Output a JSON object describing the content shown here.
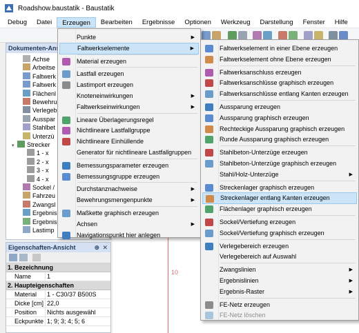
{
  "window": {
    "title": "Roadshow.baustatik - Baustatik"
  },
  "menubar": [
    {
      "label": "Debug"
    },
    {
      "label": "Datei"
    },
    {
      "label": "Erzeugen",
      "active": true
    },
    {
      "label": "Bearbeiten"
    },
    {
      "label": "Ergebnisse"
    },
    {
      "label": "Optionen"
    },
    {
      "label": "Werkzeug"
    },
    {
      "label": "Darstellung"
    },
    {
      "label": "Fenster"
    },
    {
      "label": "Hilfe"
    }
  ],
  "doc_panel": {
    "title": "Dokumenten-Ansicht",
    "items": [
      "Achse",
      "Arbeitse",
      "Faltwerk",
      "Faltwerk",
      "Flächenl",
      "Bewehru",
      "Verlegeb",
      "Ausspar",
      "Stahlbet",
      "Unterzü",
      "Strecker",
      "1 - x",
      "2 - x",
      "3 - x",
      "4 - x",
      "Sockel /",
      "Fahrzeu",
      "Zwangsl",
      "Ergebnis",
      "Ergebnis",
      "Lastimp"
    ]
  },
  "props_panel": {
    "title": "Eigenschaften-Ansicht",
    "pin_glyph": "⊕",
    "close_glyph": "✕",
    "sections": [
      {
        "label": "1. Bezeichnung",
        "rows": [
          {
            "k": "Name",
            "v": "1"
          }
        ]
      },
      {
        "label": "2. Haupteigenschaften",
        "rows": [
          {
            "k": "Material",
            "v": "1 - C30/37 B500S"
          },
          {
            "k": "Dicke [cm]",
            "v": "22,0"
          },
          {
            "k": "Position",
            "v": "Nichts ausgewähl"
          },
          {
            "k": "Eckpunkte",
            "v": "1; 9; 3; 4; 5; 6"
          }
        ]
      }
    ]
  },
  "canvas": {
    "label": "10"
  },
  "menu_erzeugen": [
    {
      "label": "Punkte",
      "sub": true
    },
    {
      "label": "Faltwerkselemente",
      "sub": true,
      "hl": true
    },
    {
      "sep": true
    },
    {
      "label": "Material erzeugen",
      "icon": "material-icon"
    },
    {
      "sep": true
    },
    {
      "label": "Lastfall erzeugen",
      "icon": "load-case-icon"
    },
    {
      "label": "Lastimport erzeugen",
      "icon": "load-import-icon"
    },
    {
      "label": "Knoteneinwirkungen",
      "sub": true
    },
    {
      "label": "Faltwerkseinwirkungen",
      "sub": true
    },
    {
      "sep": true
    },
    {
      "label": "Lineare Überlagerungsregel",
      "icon": "linear-rule-icon"
    },
    {
      "label": "Nichtlineare Lastfallgruppe",
      "icon": "nonlinear-group-icon"
    },
    {
      "label": "Nichtlineare Einhüllende",
      "icon": "envelope-icon"
    },
    {
      "label": "Generator für nichtlineare Lastfallgruppen"
    },
    {
      "sep": true
    },
    {
      "label": "Bemessungsparameter erzeugen",
      "icon": "design-param-icon"
    },
    {
      "label": "Bemessungsgruppe erzeugen",
      "icon": "design-group-icon"
    },
    {
      "sep": true
    },
    {
      "label": "Durchstanznachweise",
      "sub": true
    },
    {
      "label": "Bewehrungsmengenpunkte",
      "sub": true
    },
    {
      "sep": true
    },
    {
      "label": "Maßkette graphisch erzeugen",
      "icon": "dimension-icon"
    },
    {
      "label": "Achsen",
      "sub": true
    },
    {
      "label": "Navigationspunkt hier anlegen",
      "icon": "nav-point-icon"
    }
  ],
  "menu_faltwerk": [
    {
      "label": "Faltwerkselement in einer Ebene erzeugen",
      "icon": "plane-element-icon"
    },
    {
      "label": "Faltwerkselement ohne Ebene erzeugen",
      "icon": "free-element-icon"
    },
    {
      "sep": true
    },
    {
      "label": "Faltwerksanschluss erzeugen",
      "icon": "joint-icon"
    },
    {
      "label": "Faltwerksanschlüsse graphisch erzeugen",
      "icon": "joints-graphic-icon"
    },
    {
      "label": "Faltwerksanschlüsse entlang Kanten erzeugen",
      "icon": "joints-edges-icon"
    },
    {
      "sep": true
    },
    {
      "label": "Aussparung erzeugen",
      "icon": "opening-icon"
    },
    {
      "label": "Aussparung graphisch erzeugen",
      "icon": "opening-graphic-icon"
    },
    {
      "label": "Rechteckige Aussparung graphisch erzeugen",
      "icon": "rect-opening-icon"
    },
    {
      "label": "Runde Aussparung graphisch erzeugen",
      "icon": "round-opening-icon"
    },
    {
      "sep": true
    },
    {
      "label": "Stahlbeton-Unterzüge erzeugen",
      "icon": "rc-beam-icon"
    },
    {
      "label": "Stahlbeton-Unterzüge graphisch erzeugen",
      "icon": "rc-beam-graphic-icon"
    },
    {
      "label": "Stahl/Holz-Unterzüge",
      "sub": true
    },
    {
      "sep": true
    },
    {
      "label": "Streckenlager graphisch erzeugen",
      "icon": "line-support-icon"
    },
    {
      "label": "Streckenlager entlang Kanten erzeugen",
      "icon": "line-support-edges-icon",
      "hl": true
    },
    {
      "label": "Flächenlager graphisch erzeugen",
      "icon": "area-support-icon"
    },
    {
      "sep": true
    },
    {
      "label": "Sockel/Vertiefung erzeugen",
      "icon": "pedestal-icon"
    },
    {
      "label": "Sockel/Vertiefung graphisch erzeugen",
      "icon": "pedestal-graphic-icon"
    },
    {
      "sep": true
    },
    {
      "label": "Verlegebereich erzeugen",
      "icon": "laying-area-icon"
    },
    {
      "label": "Verlegebereich auf Auswahl"
    },
    {
      "sep": true
    },
    {
      "label": "Zwangslinien",
      "sub": true
    },
    {
      "label": "Ergebnislinien",
      "sub": true
    },
    {
      "label": "Ergebnis-Raster",
      "sub": true
    },
    {
      "sep": true
    },
    {
      "label": "FE-Netz erzeugen",
      "icon": "fe-mesh-icon"
    },
    {
      "label": "FE-Netz löschen",
      "icon": "fe-mesh-delete-icon",
      "disabled": true
    }
  ],
  "colors": {
    "highlight": "#cce4f7",
    "highlight_border": "#99c9ef",
    "panel_header": "#d5e1f2",
    "accent_red": "#e07070"
  }
}
